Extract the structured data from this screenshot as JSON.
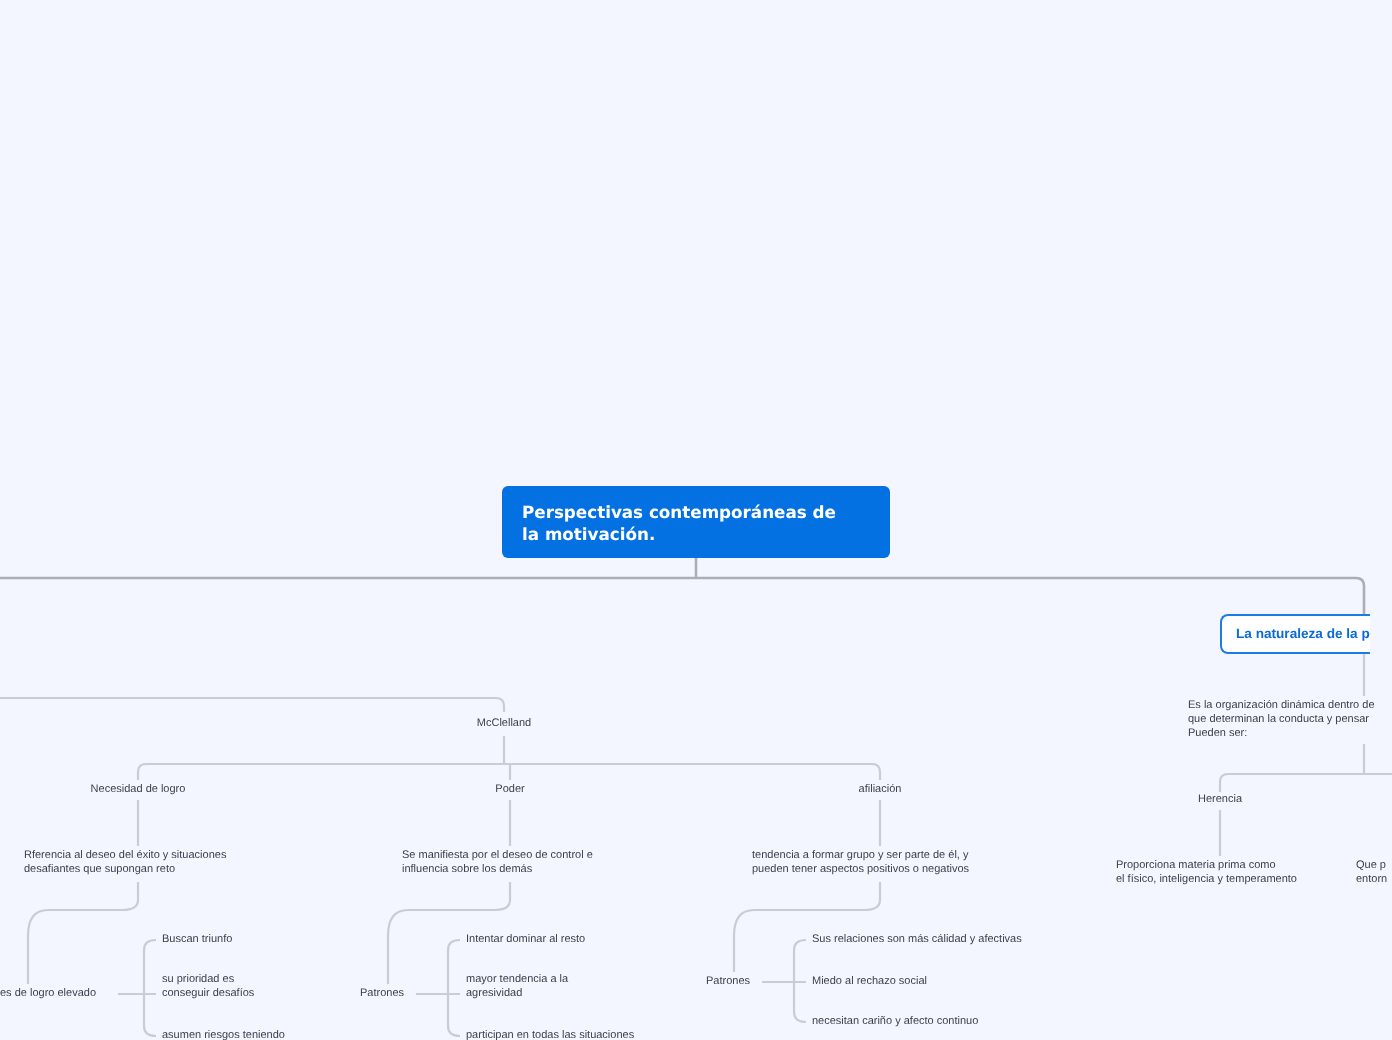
{
  "central_topic": "Perspectivas contemporáneas de\nla motivación.",
  "left_branch": {
    "title": "McClelland",
    "needs": [
      {
        "title": "Necesidad de logro",
        "description": "Rferencia al deseo del éxito y situaciones\ndesafiantes que supongan reto",
        "group": {
          "title": "es de logro elevado",
          "items": [
            "Buscan triunfo",
            "su prioridad es\nconseguir desafíos",
            "asumen riesgos teniendo"
          ]
        }
      },
      {
        "title": "Poder",
        "description": "Se manifiesta por el deseo de control e\ninfluencia sobre los demás",
        "group": {
          "title": "Patrones",
          "items": [
            "Intentar dominar al resto",
            "mayor tendencia a la\nagresividad",
            "participan en todas las situaciones"
          ]
        }
      },
      {
        "title": "afiliación",
        "description": "tendencia a formar grupo y ser parte de él, y\npueden tener aspectos positivos o negativos",
        "group": {
          "title": "Patrones",
          "items": [
            "Sus relaciones son más cálidad y afectivas",
            "Miedo al rechazo social",
            "necesitan cariño y afecto continuo"
          ]
        }
      }
    ]
  },
  "right_branch": {
    "title": "La naturaleza de la p",
    "description": "Es la organización dinámica dentro de\nque determinan la conducta y pensar\nPueden ser:",
    "factors": [
      {
        "title": "Herencia",
        "description": "Proporciona materia prima como\nel físico, inteligencia y temperamento"
      },
      {
        "description": "Que p\nentorn"
      }
    ]
  }
}
